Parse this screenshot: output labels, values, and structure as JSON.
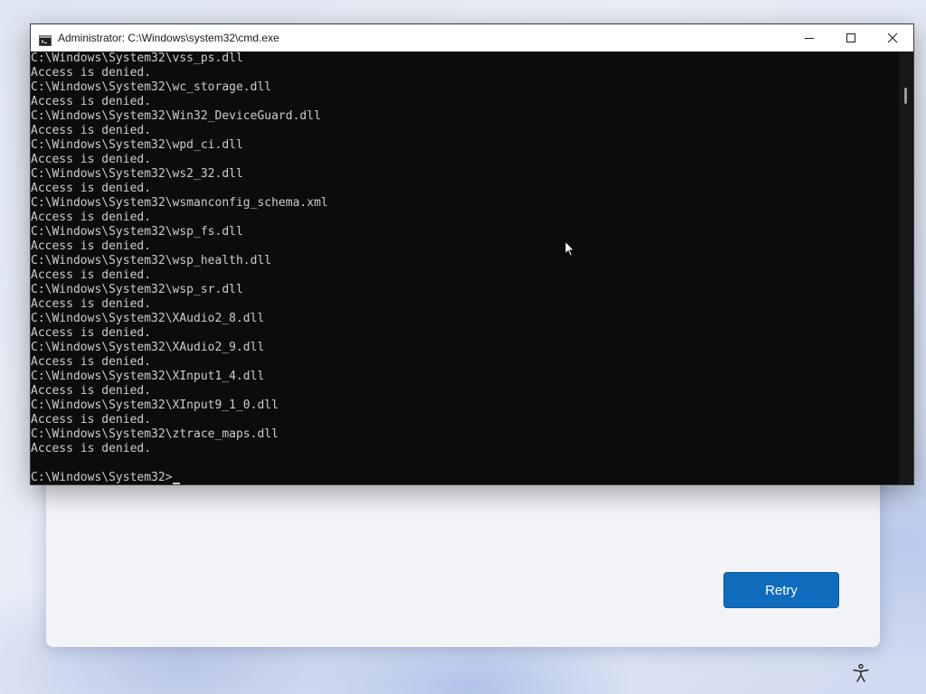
{
  "setup_dialog": {
    "retry_label": "Retry",
    "accessibility_icon": "accessibility-icon"
  },
  "cmd_window": {
    "title": "Administrator: C:\\Windows\\system32\\cmd.exe",
    "icon": "console-app-icon",
    "controls": [
      "minimize-icon",
      "maximize-icon",
      "close-icon"
    ],
    "lines": [
      "C:\\Windows\\System32\\vss_ps.dll",
      "Access is denied.",
      "C:\\Windows\\System32\\wc_storage.dll",
      "Access is denied.",
      "C:\\Windows\\System32\\Win32_DeviceGuard.dll",
      "Access is denied.",
      "C:\\Windows\\System32\\wpd_ci.dll",
      "Access is denied.",
      "C:\\Windows\\System32\\ws2_32.dll",
      "Access is denied.",
      "C:\\Windows\\System32\\wsmanconfig_schema.xml",
      "Access is denied.",
      "C:\\Windows\\System32\\wsp_fs.dll",
      "Access is denied.",
      "C:\\Windows\\System32\\wsp_health.dll",
      "Access is denied.",
      "C:\\Windows\\System32\\wsp_sr.dll",
      "Access is denied.",
      "C:\\Windows\\System32\\XAudio2_8.dll",
      "Access is denied.",
      "C:\\Windows\\System32\\XAudio2_9.dll",
      "Access is denied.",
      "C:\\Windows\\System32\\XInput1_4.dll",
      "Access is denied.",
      "C:\\Windows\\System32\\XInput9_1_0.dll",
      "Access is denied.",
      "C:\\Windows\\System32\\ztrace_maps.dll",
      "Access is denied.",
      ""
    ],
    "prompt": "C:\\Windows\\System32>"
  },
  "colors": {
    "console_background": "#0c0c0c",
    "console_text": "#cccccc",
    "retry_button": "#0f6cbd"
  }
}
